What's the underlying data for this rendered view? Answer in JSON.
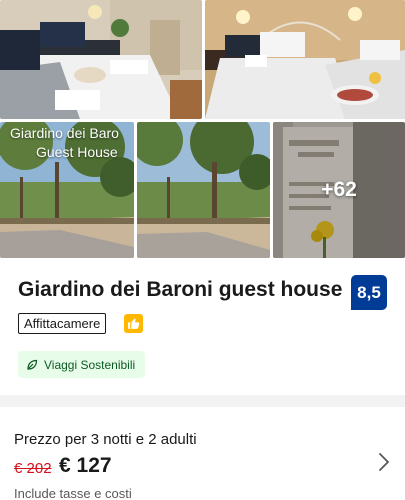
{
  "gallery": {
    "sign_line1": "Giardino dei Baro",
    "sign_line2": "Guest House",
    "more_photos": "+62"
  },
  "property": {
    "name": "Giardino dei Baroni guest house",
    "score": "8,5",
    "type_label": "Affittacamere",
    "sustainability_label": "Viaggi Sostenibili"
  },
  "price": {
    "stay_label": "Prezzo per 3 notti e 2 adulti",
    "original": "€ 202",
    "current": "€ 127",
    "taxes_note": "Include tasse e costi"
  },
  "colors": {
    "score_bg": "#003b95",
    "thumb_badge": "#ffb700",
    "old_price": "#d4111e",
    "sustain_bg": "#e7fde9"
  },
  "icons": {
    "thumb": "thumbs-up-icon",
    "leaf": "leaf-icon",
    "chevron": "chevron-right-icon"
  }
}
